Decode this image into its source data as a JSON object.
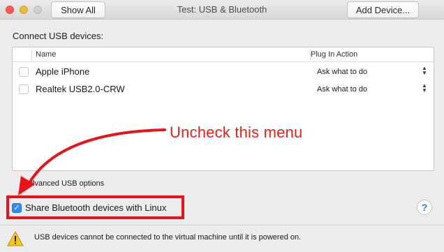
{
  "window": {
    "title": "Test: USB & Bluetooth",
    "show_all_label": "Show All",
    "add_device_label": "Add Device..."
  },
  "usb": {
    "section_label": "Connect USB devices:",
    "columns": [
      "Name",
      "Plug In Action"
    ],
    "devices": [
      {
        "name": "Apple iPhone",
        "action": "Ask what to do",
        "checked": false
      },
      {
        "name": "Realtek USB2.0-CRW",
        "action": "Ask what to do",
        "checked": false
      }
    ],
    "advanced_label": "Advanced USB options"
  },
  "bluetooth": {
    "share_label": "Share Bluetooth devices with Linux",
    "checked": true
  },
  "status": {
    "warning_text": "USB devices cannot be connected to the virtual machine until it is powered on."
  },
  "annotation": {
    "text": "Uncheck this menu",
    "color": "#e8201a"
  },
  "colors": {
    "accent": "#2f8cf5",
    "annotation": "#e8201a"
  },
  "icons": {
    "help": "help-icon",
    "warning": "warning-icon",
    "stepper": "chevron-updown-icon"
  }
}
